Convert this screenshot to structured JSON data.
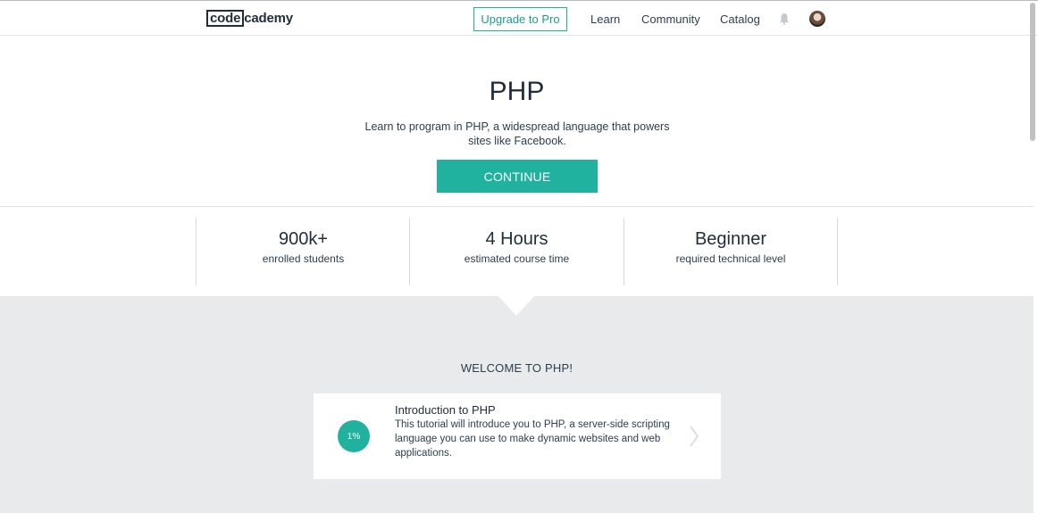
{
  "header": {
    "logo_boxed": "code",
    "logo_rest": "cademy",
    "upgrade_label": "Upgrade to Pro",
    "nav": {
      "learn": "Learn",
      "community": "Community",
      "catalog": "Catalog"
    },
    "icons": [
      "bell-icon",
      "avatar"
    ]
  },
  "hero": {
    "title": "PHP",
    "description": "Learn to program in PHP, a widespread language that powers sites like Facebook.",
    "continue_label": "CONTINUE"
  },
  "stats": [
    {
      "value": "900k+",
      "label": "enrolled students"
    },
    {
      "value": "4 Hours",
      "label": "estimated course time"
    },
    {
      "value": "Beginner",
      "label": "required technical level"
    }
  ],
  "section": {
    "heading": "WELCOME TO PHP!",
    "lesson": {
      "progress": "1%",
      "title": "Introduction to PHP",
      "description": "This tutorial will introduce you to PHP, a server-side scripting language you can use to make dynamic websites and web applications.",
      "icon": "chevron-right-icon"
    }
  },
  "colors": {
    "accent": "#20b29f",
    "text": "#1f2d3d",
    "section_bg": "#e8eaeb"
  }
}
